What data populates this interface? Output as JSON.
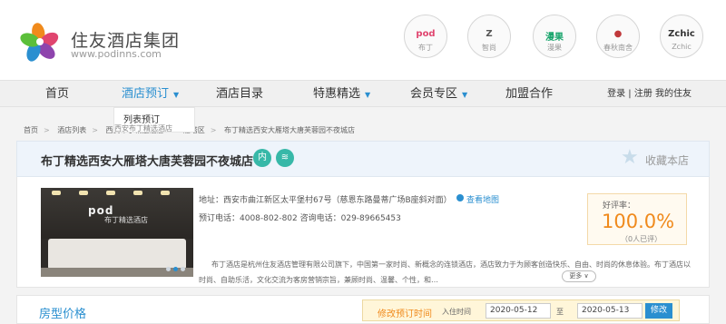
{
  "header": {
    "brand_name": "住友酒店集团",
    "brand_url": "www.podinns.com",
    "brands": [
      {
        "mark": "pod",
        "sub": "布丁",
        "color": "#e0456f"
      },
      {
        "mark": "Z",
        "sub": "智尚",
        "color": "#555555"
      },
      {
        "mark": "漫果",
        "sub": "漫果",
        "color": "#1aa56d"
      },
      {
        "mark": "●",
        "sub": "春秋南舍",
        "color": "#c0393b"
      },
      {
        "mark": "Zchic",
        "sub": "Zchic",
        "color": "#333333"
      }
    ]
  },
  "nav": {
    "items": [
      "首页",
      "酒店预订",
      "酒店目录",
      "特惠精选",
      "会员专区",
      "加盟合作"
    ],
    "right": "登录 | 注册   我的住友"
  },
  "submenu": {
    "item1": "列表预订",
    "item2": "西安布丁精选酒店"
  },
  "breadcrumb": [
    "首页",
    "酒店列表",
    "西安布丁精选酒店",
    "雁塔区",
    "布丁精选西安大雁塔大唐芙蓉园不夜城店"
  ],
  "hotel": {
    "name": "布丁精选西安大雁塔大唐芙蓉园不夜城店",
    "badge_inner": "内",
    "badge_wifi": "≋",
    "fav_label": "收藏本店",
    "photo_sign": "pod",
    "photo_sign2": "布丁精选酒店",
    "address": "地址：西安市曲江新区太平堡村67号（慈恩东路曼蒂广场B座斜对面）",
    "map_link": "查看地图",
    "phone": "预订电话：4008-802-802   咨询电话：029-89665453",
    "rating_label": "好评率：",
    "rating_value": "100.0%",
    "rating_count": "（0人已评）",
    "description": "布丁酒店是杭州住友酒店管理有限公司旗下，中国第一家时尚、新概念的连锁酒店，酒店致力于为顾客创造快乐、自由、时尚的休息体验。布丁酒店以时尚、自助乐活，文化交流为客房营销宗旨，兼顾时尚、温馨、个性，和…",
    "more_button": "更多 ∨"
  },
  "booking": {
    "title": "房型价格",
    "modify_label": "修改预订时间",
    "checkin_label": "入住时间",
    "checkin": "2020-05-12",
    "to_label": "至",
    "checkout": "2020-05-13",
    "modify_button": "修改"
  }
}
